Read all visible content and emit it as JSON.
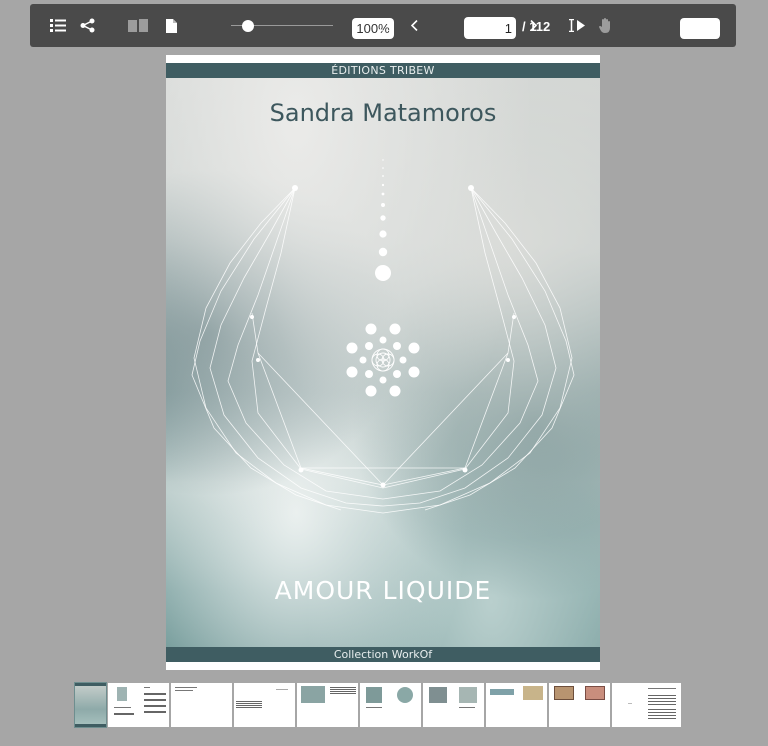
{
  "toolbar": {
    "zoom": "100%",
    "current_page": "1",
    "total_pages": "/ 112",
    "search_value": "",
    "icons": [
      "toc-icon",
      "share-icon",
      "two-page-view-icon",
      "single-page-view-icon",
      "fullscreen-icon",
      "prev-page-icon",
      "next-page-icon",
      "text-select-icon",
      "hand-tool-icon",
      "search-icon"
    ],
    "zoom_level_fraction": 0.15
  },
  "cover": {
    "publisher": "ÉDITIONS TRIBEW",
    "author": "Sandra Matamoros",
    "title": "AMOUR LIQUIDE",
    "collection": "Collection WorkOf",
    "colors": {
      "band": "#3f5d62",
      "author": "#3d575d",
      "title": "#ffffff"
    }
  },
  "thumbnails": {
    "count": 10,
    "selected_index": 0
  }
}
